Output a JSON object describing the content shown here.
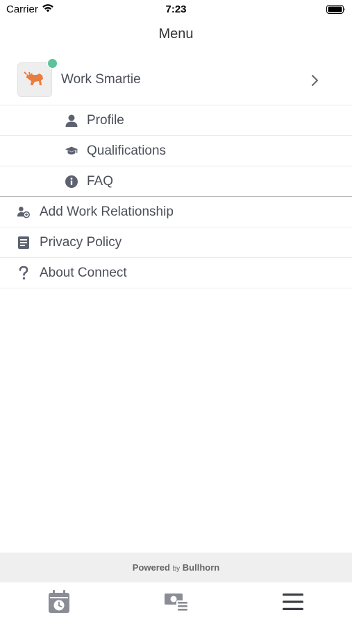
{
  "status_bar": {
    "carrier": "Carrier",
    "time": "7:23"
  },
  "nav": {
    "title": "Menu"
  },
  "account": {
    "name": "Work Smartie",
    "online_color": "#5cc39a",
    "logo_color": "#e87d3e"
  },
  "submenu": [
    {
      "label": "Profile",
      "icon": "person-icon"
    },
    {
      "label": "Qualifications",
      "icon": "graduation-cap-icon"
    },
    {
      "label": "FAQ",
      "icon": "info-icon"
    }
  ],
  "menu": [
    {
      "label": "Add Work Relationship",
      "icon": "add-relationship-icon"
    },
    {
      "label": "Privacy Policy",
      "icon": "document-icon"
    },
    {
      "label": "About Connect",
      "icon": "question-icon"
    }
  ],
  "footer": {
    "powered": "Powered",
    "by": "by",
    "brand": "Bullhorn"
  },
  "tabs": [
    {
      "name": "schedule-tab",
      "icon": "calendar-clock-icon"
    },
    {
      "name": "pay-tab",
      "icon": "money-list-icon"
    },
    {
      "name": "menu-tab",
      "icon": "hamburger-icon",
      "active": true
    }
  ],
  "colors": {
    "text": "#4b4f58",
    "icon": "#5e6270",
    "inactive_tab": "#8a8d95",
    "active_tab": "#3a3d44"
  }
}
